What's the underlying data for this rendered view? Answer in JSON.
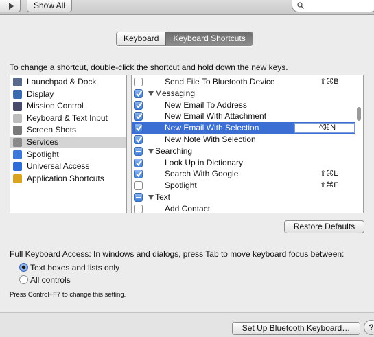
{
  "toolbar": {
    "show_all": "Show All",
    "search_placeholder": ""
  },
  "tabs": [
    "Keyboard",
    "Keyboard Shortcuts"
  ],
  "active_tab": "Keyboard Shortcuts",
  "instruction": "To change a shortcut, double-click the shortcut and hold down the new keys.",
  "categories": [
    {
      "label": "Launchpad & Dock",
      "icon": "launchpad-dock-icon",
      "color": "#5a6a8a"
    },
    {
      "label": "Display",
      "icon": "display-icon",
      "color": "#3a6ab0"
    },
    {
      "label": "Mission Control",
      "icon": "mission-control-icon",
      "color": "#4a4a6a"
    },
    {
      "label": "Keyboard & Text Input",
      "icon": "keyboard-icon",
      "color": "#bdbdbd"
    },
    {
      "label": "Screen Shots",
      "icon": "screenshot-icon",
      "color": "#7a7a7a"
    },
    {
      "label": "Services",
      "icon": "gear-icon",
      "color": "#8a8a8a",
      "selected": true
    },
    {
      "label": "Spotlight",
      "icon": "spotlight-icon",
      "color": "#3b78d8"
    },
    {
      "label": "Universal Access",
      "icon": "universal-access-icon",
      "color": "#2f6ed6"
    },
    {
      "label": "Application Shortcuts",
      "icon": "app-shortcuts-icon",
      "color": "#d9a520"
    }
  ],
  "shortcuts": [
    {
      "type": "item",
      "label": "Send File To Bluetooth Device",
      "key": "⇧⌘B",
      "check": "off"
    },
    {
      "type": "group",
      "label": "Messaging",
      "check": "on"
    },
    {
      "type": "item",
      "label": "New Email To Address",
      "key": "",
      "check": "on"
    },
    {
      "type": "item",
      "label": "New Email With Attachment",
      "key": "",
      "check": "on"
    },
    {
      "type": "item",
      "label": "New Email With Selection",
      "key": "^⌘N",
      "check": "on",
      "selected": true
    },
    {
      "type": "item",
      "label": "New Note With Selection",
      "key": "",
      "check": "on"
    },
    {
      "type": "group",
      "label": "Searching",
      "check": "mixed"
    },
    {
      "type": "item",
      "label": "Look Up in Dictionary",
      "key": "",
      "check": "on"
    },
    {
      "type": "item",
      "label": "Search With Google",
      "key": "⇧⌘L",
      "check": "on"
    },
    {
      "type": "item",
      "label": "Spotlight",
      "key": "⇧⌘F",
      "check": "off"
    },
    {
      "type": "group",
      "label": "Text",
      "check": "mixed"
    },
    {
      "type": "item",
      "label": "Add Contact",
      "key": "",
      "check": "off"
    }
  ],
  "restore_defaults": "Restore Defaults",
  "full_keyboard_access": "Full Keyboard Access: In windows and dialogs, press Tab to move keyboard focus between:",
  "radio_options": [
    {
      "label": "Text boxes and lists only",
      "selected": true
    },
    {
      "label": "All controls",
      "selected": false
    }
  ],
  "hint": "Press Control+F7 to change this setting.",
  "bluetooth_button": "Set Up Bluetooth Keyboard…",
  "help_button": "?",
  "colors": {
    "selection": "#3b6fd4",
    "checkbox": "#3f7fd9",
    "window_bg": "#ececec"
  }
}
